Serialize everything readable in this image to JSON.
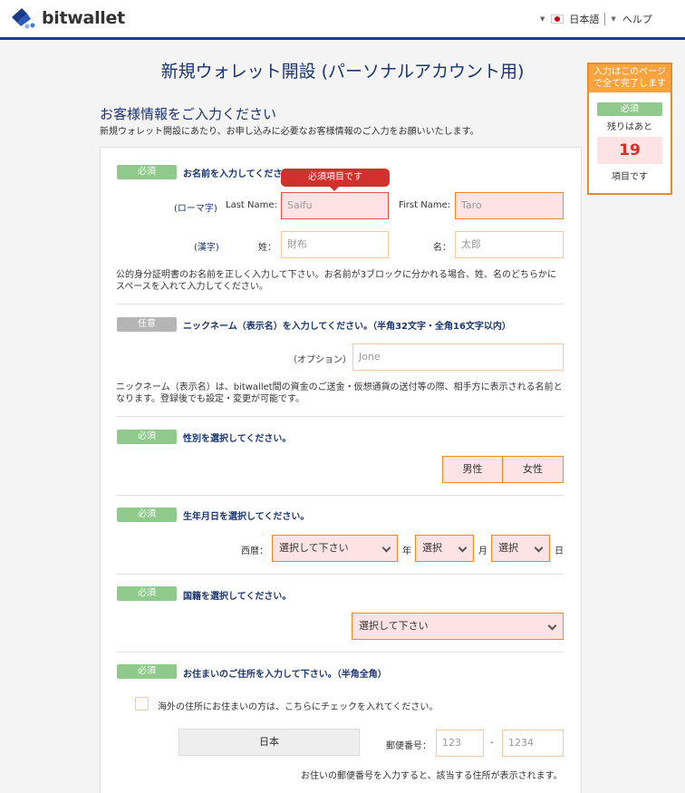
{
  "header": {
    "brand": "bitwallet",
    "language": "日本語",
    "help": "ヘルプ"
  },
  "page_title": "新規ウォレット開設 (パーソナルアカウント用)",
  "progress": {
    "head": "入力はこのページで全て完了します",
    "badge": "必須",
    "remaining_label": "残りはあと",
    "count": "19",
    "unit": "項目です"
  },
  "section": {
    "title": "お客様情報をご入力ください",
    "desc": "新規ウォレット開設にあたり、お申し込みに必要なお客様情報のご入力をお願いいたします。"
  },
  "name": {
    "badge": "必須",
    "question": "お名前を入力してください",
    "tooltip": "必須項目です",
    "roman_label": "(ローマ字)",
    "last_name_label": "Last Name:",
    "last_name_placeholder": "Saifu",
    "first_name_label": "First Name:",
    "first_name_placeholder": "Taro",
    "kanji_label": "(漢字)",
    "sei_label": "姓：",
    "sei_placeholder": "財布",
    "mei_label": "名：",
    "mei_placeholder": "太郎",
    "note": "公的身分証明書のお名前を正しく入力して下さい。お名前が3ブロックに分かれる場合、姓、名のどちらかにスペースを入れて入力してください。"
  },
  "nickname": {
    "badge": "任意",
    "question": "ニックネーム（表示名）を入力してください。（半角32文字・全角16文字以内）",
    "option_label": "（オプション）",
    "placeholder": "Jone",
    "note": "ニックネーム（表示名）は、bitwallet間の資金のご送金・仮想通貨の送付等の際、相手方に表示される名前となります。登録後でも設定・変更が可能です。"
  },
  "gender": {
    "badge": "必須",
    "question": "性別を選択してください。",
    "male": "男性",
    "female": "女性"
  },
  "birth": {
    "badge": "必須",
    "question": "生年月日を選択してください。",
    "era_label": "西暦：",
    "year_value": "選択して下さい",
    "year_unit": "年",
    "month_value": "選択",
    "month_unit": "月",
    "day_value": "選択",
    "day_unit": "日"
  },
  "nationality": {
    "badge": "必須",
    "question": "国籍を選択してください。",
    "value": "選択して下さい"
  },
  "address": {
    "badge": "必須",
    "question": "お住まいのご住所を入力して下さい。（半角全角）",
    "overseas_check": "海外の住所にお住まいの方は、こちらにチェックを入れてください。",
    "country": "日本",
    "postal_label": "郵便番号：",
    "postal1_placeholder": "123",
    "postal_dash": "-",
    "postal2_placeholder": "1234",
    "postal_note": "お住いの郵便番号を入力すると、該当する住所が表示されます。"
  }
}
